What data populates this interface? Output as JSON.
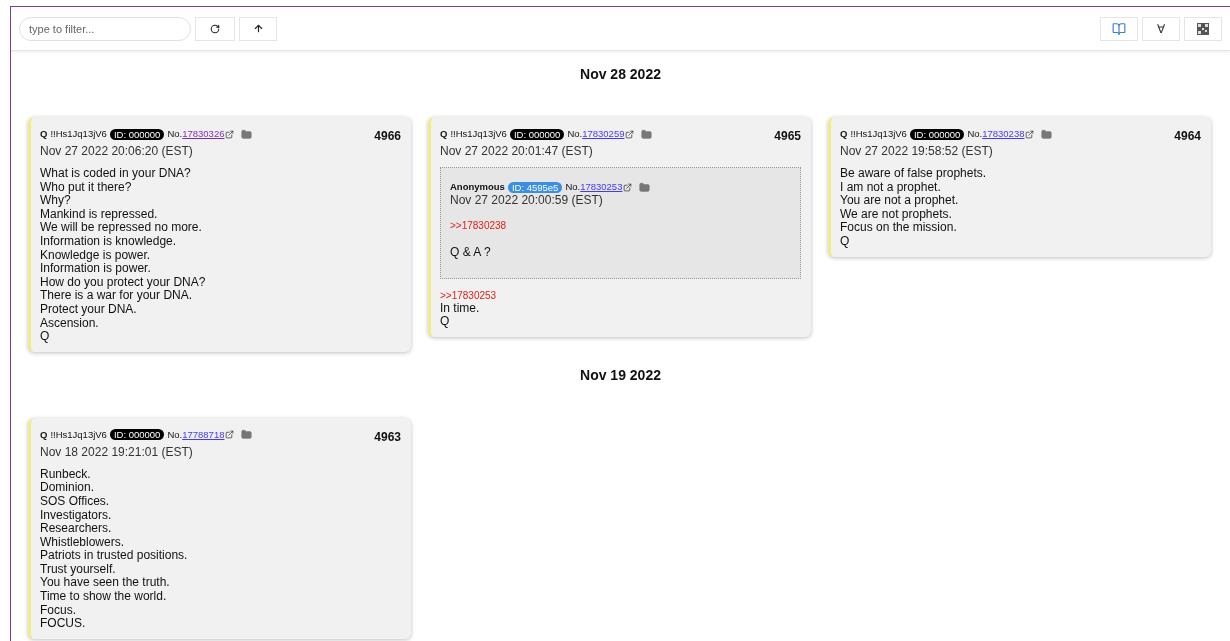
{
  "toolbar": {
    "filter": {
      "placeholder": "type to filter..."
    },
    "right_buttons": [
      {
        "kind": "book"
      },
      {
        "kind": "text",
        "label": "∀"
      },
      {
        "kind": "qr"
      }
    ]
  },
  "groups": [
    {
      "date": "Nov 28 2022",
      "posts": [
        {
          "author": "Q",
          "tripcode": "!!Hs1Jq13jV6",
          "id": "ID: 000000",
          "color": "#000000",
          "no_label": "No.",
          "no": "17830326",
          "visited": true,
          "timestamp": "Nov 27 2022 20:06:20 (EST)",
          "number": "4966",
          "lines": [
            {
              "kind": "text",
              "text": "What is coded in your DNA?"
            },
            {
              "kind": "text",
              "text": "Who put it there?"
            },
            {
              "kind": "text",
              "text": "Why?"
            },
            {
              "kind": "text",
              "text": "Mankind is repressed."
            },
            {
              "kind": "text",
              "text": "We will be repressed no more."
            },
            {
              "kind": "text",
              "text": "Information is knowledge."
            },
            {
              "kind": "text",
              "text": "Knowledge is power."
            },
            {
              "kind": "text",
              "text": "Information is power."
            },
            {
              "kind": "text",
              "text": "How do you protect your DNA?"
            },
            {
              "kind": "text",
              "text": "There is a war for your DNA."
            },
            {
              "kind": "text",
              "text": "Protect your DNA."
            },
            {
              "kind": "text",
              "text": "Ascension."
            },
            {
              "kind": "text",
              "text": "Q"
            }
          ]
        },
        {
          "author": "Q",
          "tripcode": "!!Hs1Jq13jV6",
          "id": "ID: 000000",
          "color": "#000000",
          "no_label": "No.",
          "no": "17830259",
          "visited": false,
          "timestamp": "Nov 27 2022 20:01:47 (EST)",
          "number": "4965",
          "quote": {
            "author": "Anonymous",
            "id": "ID: 4595e5",
            "color": "#3b8fe3",
            "no_label": "No.",
            "no": "17830253",
            "visited": false,
            "timestamp": "Nov 27 2022 20:00:59 (EST)",
            "lines": [
              {
                "kind": "ref",
                "text": ">>17830238"
              },
              {
                "kind": "gap"
              },
              {
                "kind": "text",
                "text": "Q & A ?"
              }
            ]
          },
          "lines": [
            {
              "kind": "ref",
              "text": ">>17830253"
            },
            {
              "kind": "text",
              "text": "In time."
            },
            {
              "kind": "text",
              "text": "Q"
            }
          ]
        },
        {
          "author": "Q",
          "tripcode": "!!Hs1Jq13jV6",
          "id": "ID: 000000",
          "color": "#000000",
          "no_label": "No.",
          "no": "17830238",
          "visited": false,
          "timestamp": "Nov 27 2022 19:58:52 (EST)",
          "number": "4964",
          "lines": [
            {
              "kind": "text",
              "text": "Be aware of false prophets."
            },
            {
              "kind": "text",
              "text": "I am not a prophet."
            },
            {
              "kind": "text",
              "text": "You are not a prophet."
            },
            {
              "kind": "text",
              "text": "We are not prophets."
            },
            {
              "kind": "text",
              "text": "Focus on the mission."
            },
            {
              "kind": "text",
              "text": "Q"
            }
          ]
        }
      ]
    },
    {
      "date": "Nov 19 2022",
      "posts": [
        {
          "author": "Q",
          "tripcode": "!!Hs1Jq13jV6",
          "id": "ID: 000000",
          "color": "#000000",
          "no_label": "No.",
          "no": "17788718",
          "visited": false,
          "timestamp": "Nov 18 2022 19:21:01 (EST)",
          "number": "4963",
          "lines": [
            {
              "kind": "text",
              "text": "Runbeck."
            },
            {
              "kind": "text",
              "text": "Dominion."
            },
            {
              "kind": "text",
              "text": "SOS Offices."
            },
            {
              "kind": "text",
              "text": "Investigators."
            },
            {
              "kind": "text",
              "text": "Researchers."
            },
            {
              "kind": "text",
              "text": "Whistleblowers."
            },
            {
              "kind": "text",
              "text": "Patriots in trusted positions."
            },
            {
              "kind": "text",
              "text": "Trust yourself."
            },
            {
              "kind": "text",
              "text": "You have seen the truth."
            },
            {
              "kind": "text",
              "text": "Time to show the world."
            },
            {
              "kind": "text",
              "text": "Focus."
            },
            {
              "kind": "text",
              "text": "FOCUS."
            }
          ]
        }
      ]
    }
  ]
}
